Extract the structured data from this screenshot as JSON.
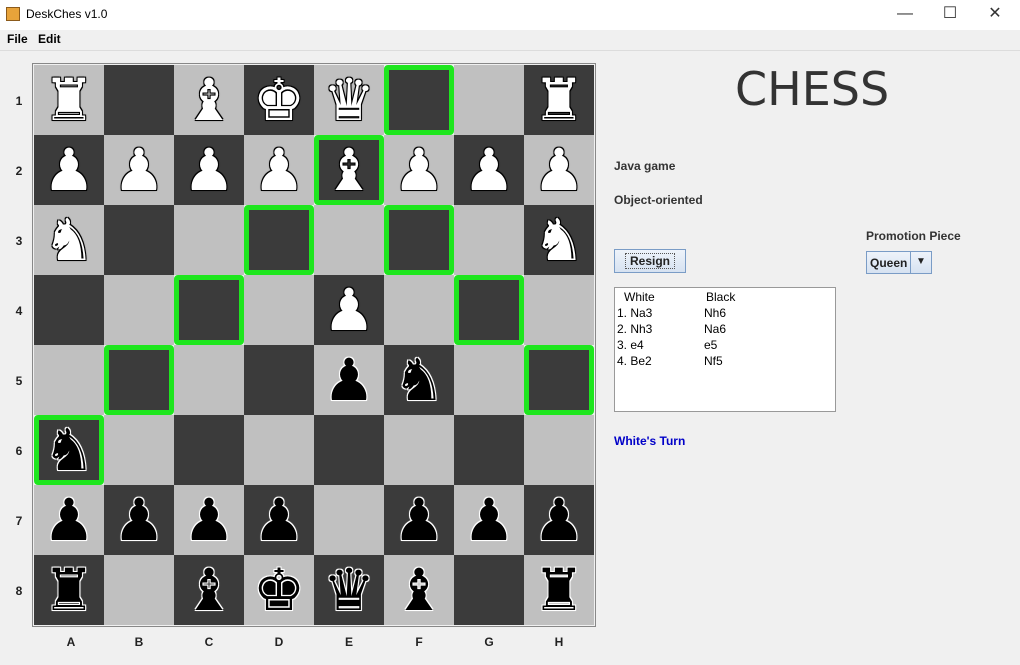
{
  "window": {
    "title": "DeskChes v1.0",
    "minimize": "—",
    "maximize": "☐",
    "close": "✕"
  },
  "menu": {
    "file": "File",
    "edit": "Edit"
  },
  "board": {
    "ranks": [
      "1",
      "2",
      "3",
      "4",
      "5",
      "6",
      "7",
      "8"
    ],
    "files": [
      "A",
      "B",
      "C",
      "D",
      "E",
      "F",
      "G",
      "H"
    ],
    "rows": [
      [
        {
          "piece": "rook",
          "color": "white",
          "glyph": "♜"
        },
        {
          "piece": "",
          "color": "",
          "glyph": ""
        },
        {
          "piece": "bishop",
          "color": "white",
          "glyph": "♝"
        },
        {
          "piece": "king",
          "color": "white",
          "glyph": "♚"
        },
        {
          "piece": "queen",
          "color": "white",
          "glyph": "♛"
        },
        {
          "piece": "",
          "color": "",
          "glyph": "",
          "highlight": true
        },
        {
          "piece": "",
          "color": "",
          "glyph": ""
        },
        {
          "piece": "rook",
          "color": "white",
          "glyph": "♜"
        }
      ],
      [
        {
          "piece": "pawn",
          "color": "white",
          "glyph": "♟"
        },
        {
          "piece": "pawn",
          "color": "white",
          "glyph": "♟"
        },
        {
          "piece": "pawn",
          "color": "white",
          "glyph": "♟"
        },
        {
          "piece": "pawn",
          "color": "white",
          "glyph": "♟"
        },
        {
          "piece": "bishop",
          "color": "white",
          "glyph": "♝",
          "highlight": true
        },
        {
          "piece": "pawn",
          "color": "white",
          "glyph": "♟"
        },
        {
          "piece": "pawn",
          "color": "white",
          "glyph": "♟"
        },
        {
          "piece": "pawn",
          "color": "white",
          "glyph": "♟"
        }
      ],
      [
        {
          "piece": "knight",
          "color": "white",
          "glyph": "♞"
        },
        {
          "piece": "",
          "color": "",
          "glyph": ""
        },
        {
          "piece": "",
          "color": "",
          "glyph": ""
        },
        {
          "piece": "",
          "color": "",
          "glyph": "",
          "highlight": true
        },
        {
          "piece": "",
          "color": "",
          "glyph": ""
        },
        {
          "piece": "",
          "color": "",
          "glyph": "",
          "highlight": true
        },
        {
          "piece": "",
          "color": "",
          "glyph": ""
        },
        {
          "piece": "knight",
          "color": "white",
          "glyph": "♞"
        }
      ],
      [
        {
          "piece": "",
          "color": "",
          "glyph": ""
        },
        {
          "piece": "",
          "color": "",
          "glyph": ""
        },
        {
          "piece": "",
          "color": "",
          "glyph": "",
          "highlight": true
        },
        {
          "piece": "",
          "color": "",
          "glyph": ""
        },
        {
          "piece": "pawn",
          "color": "white",
          "glyph": "♟"
        },
        {
          "piece": "",
          "color": "",
          "glyph": ""
        },
        {
          "piece": "",
          "color": "",
          "glyph": "",
          "highlight": true
        },
        {
          "piece": "",
          "color": "",
          "glyph": ""
        }
      ],
      [
        {
          "piece": "",
          "color": "",
          "glyph": ""
        },
        {
          "piece": "",
          "color": "",
          "glyph": "",
          "highlight": true
        },
        {
          "piece": "",
          "color": "",
          "glyph": ""
        },
        {
          "piece": "",
          "color": "",
          "glyph": ""
        },
        {
          "piece": "pawn",
          "color": "black",
          "glyph": "♟"
        },
        {
          "piece": "knight",
          "color": "black",
          "glyph": "♞"
        },
        {
          "piece": "",
          "color": "",
          "glyph": ""
        },
        {
          "piece": "",
          "color": "",
          "glyph": "",
          "highlight": true
        }
      ],
      [
        {
          "piece": "knight",
          "color": "black",
          "glyph": "♞",
          "highlight": true
        },
        {
          "piece": "",
          "color": "",
          "glyph": ""
        },
        {
          "piece": "",
          "color": "",
          "glyph": ""
        },
        {
          "piece": "",
          "color": "",
          "glyph": ""
        },
        {
          "piece": "",
          "color": "",
          "glyph": ""
        },
        {
          "piece": "",
          "color": "",
          "glyph": ""
        },
        {
          "piece": "",
          "color": "",
          "glyph": ""
        },
        {
          "piece": "",
          "color": "",
          "glyph": ""
        }
      ],
      [
        {
          "piece": "pawn",
          "color": "black",
          "glyph": "♟"
        },
        {
          "piece": "pawn",
          "color": "black",
          "glyph": "♟"
        },
        {
          "piece": "pawn",
          "color": "black",
          "glyph": "♟"
        },
        {
          "piece": "pawn",
          "color": "black",
          "glyph": "♟"
        },
        {
          "piece": "",
          "color": "",
          "glyph": ""
        },
        {
          "piece": "pawn",
          "color": "black",
          "glyph": "♟"
        },
        {
          "piece": "pawn",
          "color": "black",
          "glyph": "♟"
        },
        {
          "piece": "pawn",
          "color": "black",
          "glyph": "♟"
        }
      ],
      [
        {
          "piece": "rook",
          "color": "black",
          "glyph": "♜"
        },
        {
          "piece": "",
          "color": "",
          "glyph": ""
        },
        {
          "piece": "bishop",
          "color": "black",
          "glyph": "♝"
        },
        {
          "piece": "king",
          "color": "black",
          "glyph": "♚"
        },
        {
          "piece": "queen",
          "color": "black",
          "glyph": "♛"
        },
        {
          "piece": "bishop",
          "color": "black",
          "glyph": "♝"
        },
        {
          "piece": "",
          "color": "",
          "glyph": ""
        },
        {
          "piece": "rook",
          "color": "black",
          "glyph": "♜"
        }
      ]
    ]
  },
  "side": {
    "title": "CHESS",
    "line1": "Java game",
    "line2": "Object-oriented",
    "resign": "Resign",
    "moves_header": {
      "white": "White",
      "black": "Black"
    },
    "moves": [
      {
        "white": "1. Na3",
        "black": "Nh6"
      },
      {
        "white": "2. Nh3",
        "black": "Na6"
      },
      {
        "white": "3. e4",
        "black": "e5"
      },
      {
        "white": "4. Be2",
        "black": "Nf5"
      }
    ],
    "turn": "White's Turn",
    "promotion_label": "Promotion Piece",
    "promotion_value": "Queen"
  },
  "colors": {
    "light_square": "#c0c0c0",
    "dark_square": "#3b3b3b",
    "highlight": "#1ee61e",
    "turn_text": "#0000c8"
  }
}
